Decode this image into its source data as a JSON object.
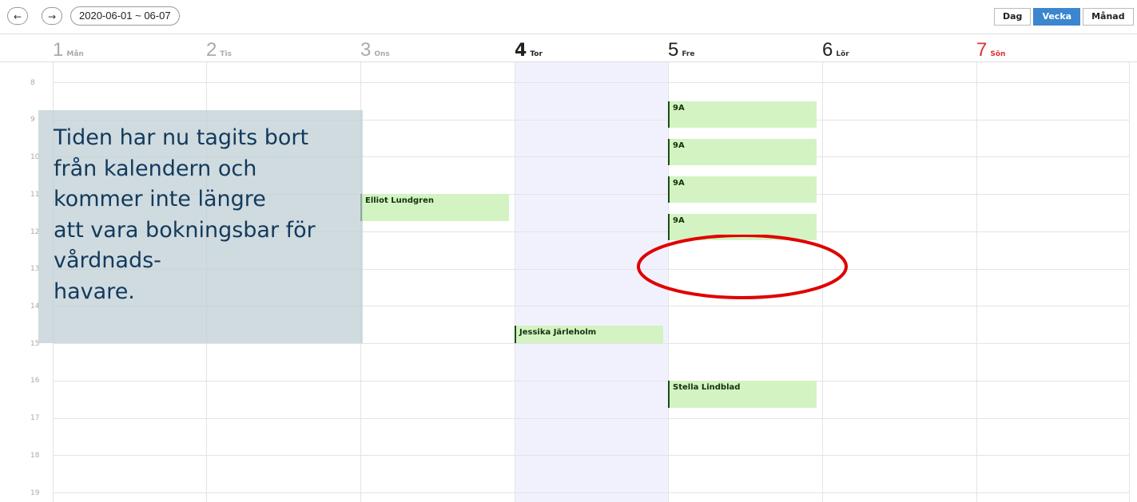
{
  "toolbar": {
    "prev_icon": "arrow-left-icon",
    "next_icon": "arrow-right-icon",
    "prev_glyph": "←",
    "next_glyph": "→",
    "date_range": "2020-06-01 ~ 06-07",
    "views": [
      {
        "label": "Dag",
        "active": false
      },
      {
        "label": "Vecka",
        "active": true
      },
      {
        "label": "Månad",
        "active": false
      }
    ]
  },
  "days": [
    {
      "num": "1",
      "name": "Mån",
      "state": "past"
    },
    {
      "num": "2",
      "name": "Tis",
      "state": "past"
    },
    {
      "num": "3",
      "name": "Ons",
      "state": "past"
    },
    {
      "num": "4",
      "name": "Tor",
      "state": "today"
    },
    {
      "num": "5",
      "name": "Fre",
      "state": "normal"
    },
    {
      "num": "6",
      "name": "Lör",
      "state": "normal"
    },
    {
      "num": "7",
      "name": "Sön",
      "state": "sunday"
    }
  ],
  "hours": [
    "8",
    "9",
    "10",
    "11",
    "12",
    "13",
    "14",
    "15",
    "16",
    "17",
    "18",
    "19"
  ],
  "events": [
    {
      "title": "9A",
      "day": "Fre",
      "start": "9:30"
    },
    {
      "title": "9A",
      "day": "Fre",
      "start": "10:30"
    },
    {
      "title": "9A",
      "day": "Fre",
      "start": "11:30"
    },
    {
      "title": "9A",
      "day": "Fre",
      "start": "12:30"
    },
    {
      "title": "Elliot Lundgren",
      "day": "Ons",
      "start": "11:00"
    },
    {
      "title": "Jessika Järleholm",
      "day": "Tor",
      "start": "14:30"
    },
    {
      "title": "Stella Lindblad",
      "day": "Fre",
      "start": "16:00"
    }
  ],
  "note": {
    "lines": [
      "Tiden har nu tagits bort",
      "från kalendern och",
      "kommer inte längre",
      "att vara bokningsbar för",
      "vårdnads-",
      "havare."
    ]
  },
  "colors": {
    "accent": "#3c86cf",
    "event_bg": "#d3f3c2",
    "event_border": "#1c4d12",
    "today_bg": "#f1f1fd",
    "sunday": "#e03030",
    "highlight_ring": "#e00000",
    "note_text": "#123a5c"
  }
}
